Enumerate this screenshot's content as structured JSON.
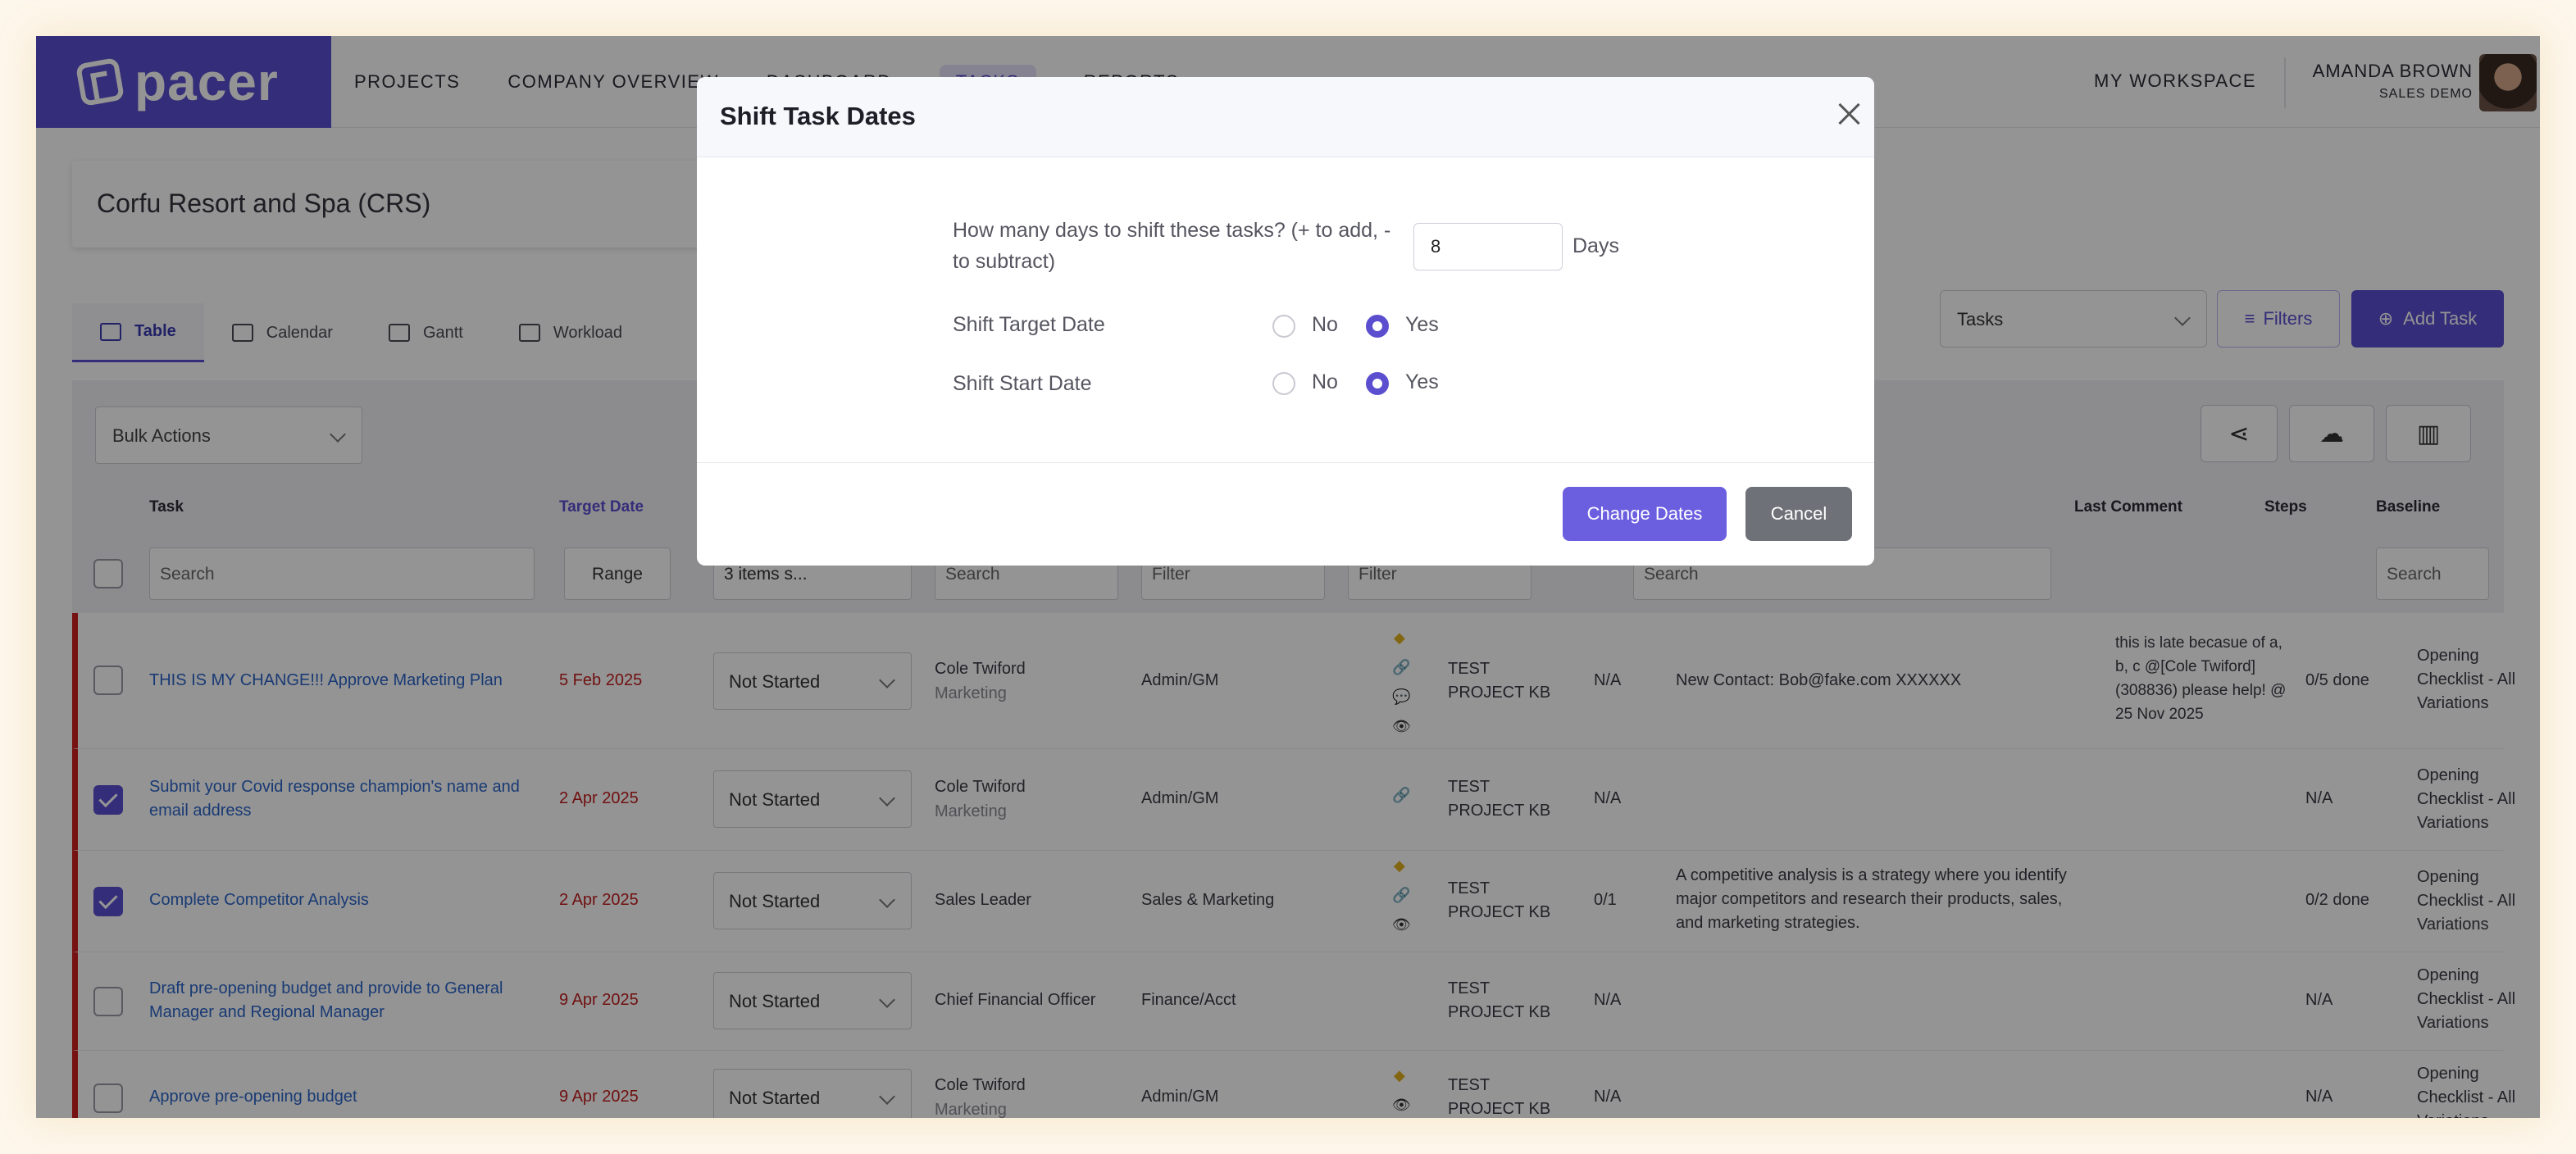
{
  "app": {
    "logo": "pacer"
  },
  "nav": {
    "items": [
      "PROJECTS",
      "COMPANY OVERVIEW",
      "DASHBOARD",
      "TASKS",
      "REPORTS"
    ],
    "workspace": "MY WORKSPACE"
  },
  "user": {
    "name": "AMANDA BROWN",
    "subtitle": "SALES DEMO"
  },
  "project": {
    "title": "Corfu Resort and Spa (CRS)"
  },
  "view_tabs": [
    "Table",
    "Calendar",
    "Gantt",
    "Workload"
  ],
  "toolbar": {
    "tasks_select": "Tasks",
    "filters": "Filters",
    "add_task": "Add Task",
    "bulk_actions": "Bulk Actions"
  },
  "columns": {
    "task": "Task",
    "target_date": "Target Date",
    "last_comment": "Last Comment",
    "steps": "Steps",
    "baseline": "Baseline"
  },
  "filters": {
    "task_search": "Search",
    "range": "Range",
    "status_select": "3 items s...",
    "assignee_search": "Search",
    "dept_filter": "Filter",
    "icons_filter": "Filter",
    "comment_search": "Search",
    "baseline_search": "Search"
  },
  "rows": [
    {
      "task": "THIS IS MY CHANGE!!! Approve Marketing Plan",
      "date": "5 Feb 2025",
      "status": "Not Started",
      "assignee": "Cole Twiford",
      "assignee_sub": "Marketing",
      "dept": "Admin/GM",
      "project": "TEST PROJECT KB",
      "ratio": "N/A",
      "note": "New Contact: Bob@fake.com XXXXXX",
      "last_comment": "this is late becasue of a, b, c  @[Cole Twiford](308836) please help! @ 25 Nov 2025",
      "steps": "0/5 done",
      "baseline": "Opening Checklist - All Variations",
      "checked": false
    },
    {
      "task": "Submit your Covid response champion's name and email address",
      "date": "2 Apr 2025",
      "status": "Not Started",
      "assignee": "Cole Twiford",
      "assignee_sub": "Marketing",
      "dept": "Admin/GM",
      "project": "TEST PROJECT KB",
      "ratio": "N/A",
      "note": "",
      "last_comment": "",
      "steps": "N/A",
      "baseline": "Opening Checklist - All Variations",
      "checked": true
    },
    {
      "task": "Complete Competitor Analysis",
      "date": "2 Apr 2025",
      "status": "Not Started",
      "assignee": "Sales Leader",
      "assignee_sub": "",
      "dept": "Sales & Marketing",
      "project": "TEST PROJECT KB",
      "ratio": "0/1",
      "note": "A competitive analysis is a strategy where you identify major competitors and research their products, sales, and marketing strategies.",
      "last_comment": "",
      "steps": "0/2 done",
      "baseline": "Opening Checklist - All Variations",
      "checked": true
    },
    {
      "task": "Draft pre-opening budget and provide to General Manager and Regional Manager",
      "date": "9 Apr 2025",
      "status": "Not Started",
      "assignee": "Chief Financial Officer",
      "assignee_sub": "",
      "dept": "Finance/Acct",
      "project": "TEST PROJECT KB",
      "ratio": "N/A",
      "note": "",
      "last_comment": "",
      "steps": "N/A",
      "baseline": "Opening Checklist - All Variations",
      "checked": false
    },
    {
      "task": "Approve pre-opening budget",
      "date": "9 Apr 2025",
      "status": "Not Started",
      "assignee": "Cole Twiford",
      "assignee_sub": "Marketing",
      "dept": "Admin/GM",
      "project": "TEST PROJECT KB",
      "ratio": "N/A",
      "note": "",
      "last_comment": "",
      "steps": "N/A",
      "baseline": "Opening Checklist - All Variations",
      "checked": false
    }
  ],
  "modal": {
    "title": "Shift Task Dates",
    "question": "How many days to shift these tasks? (+ to add, - to subtract)",
    "days_value": "8",
    "days_label": "Days",
    "shift_target_label": "Shift Target Date",
    "shift_start_label": "Shift Start Date",
    "no_label": "No",
    "yes_label": "Yes",
    "shift_target_value": "Yes",
    "shift_start_value": "Yes",
    "change_button": "Change Dates",
    "cancel_button": "Cancel"
  },
  "colors": {
    "brand": "#5b4fd0",
    "overdue": "#cc1f1f",
    "link": "#2b64c8"
  }
}
